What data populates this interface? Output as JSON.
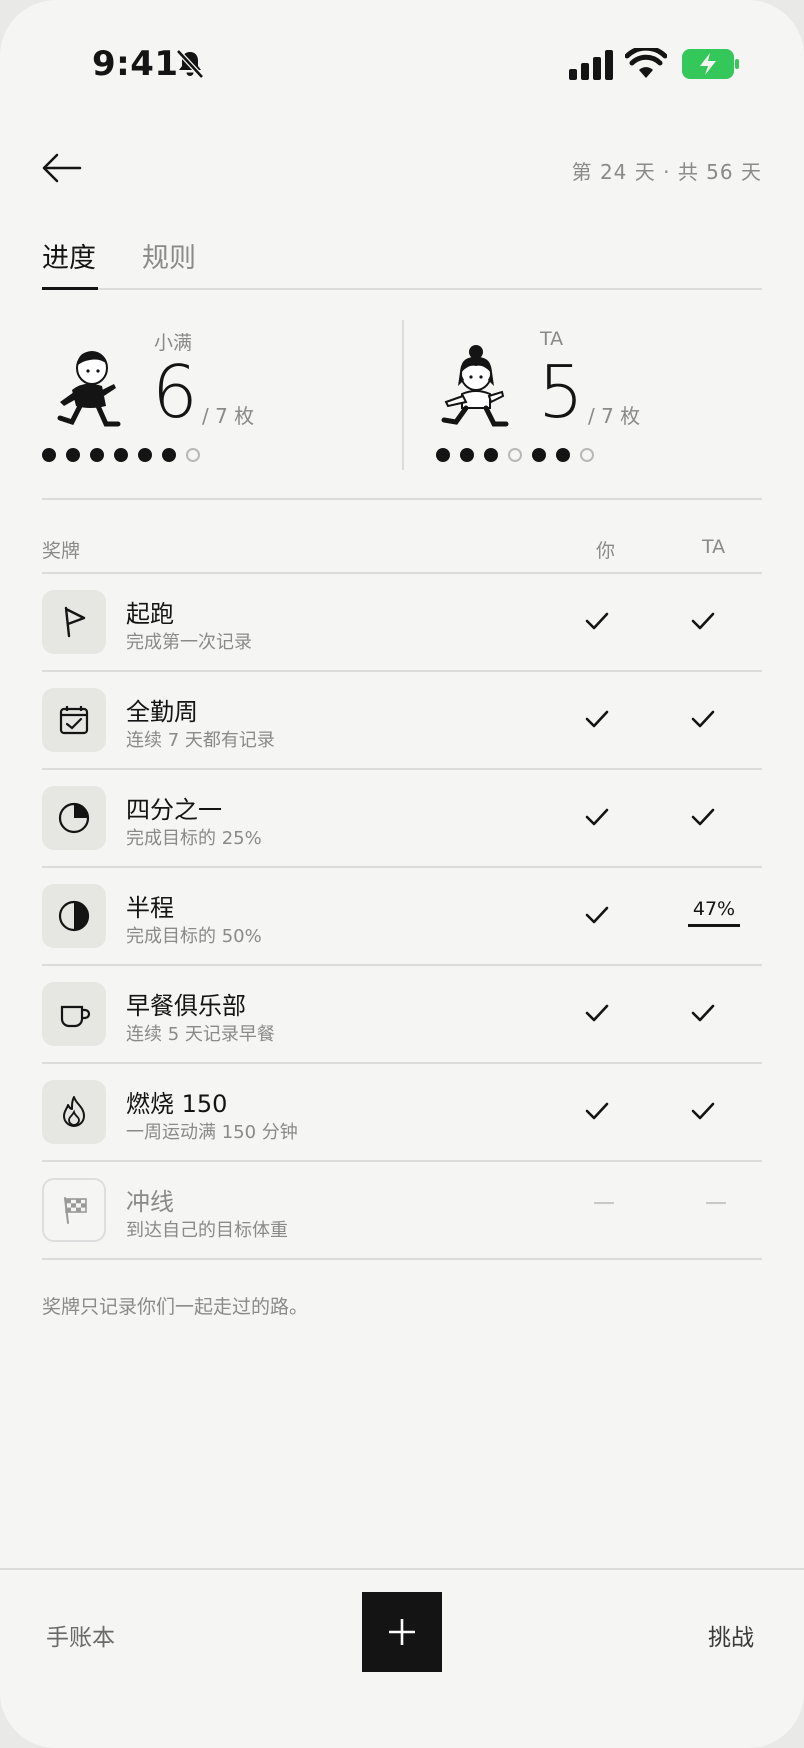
{
  "status_bar": {
    "time": "9:41",
    "icons": [
      "bell-slash-icon",
      "cellular-signal-icon",
      "wifi-icon",
      "battery-charging-icon"
    ],
    "battery_color": "#34c759"
  },
  "header": {
    "back_icon": "arrow-left-icon",
    "day_counter": "第 24 天 · 共 56 天"
  },
  "tabs": [
    {
      "label": "进度",
      "active": true
    },
    {
      "label": "规则",
      "active": false
    }
  ],
  "scores": {
    "me": {
      "name": "小满",
      "count": "6",
      "total": "/ 7 枚",
      "dots": [
        true,
        true,
        true,
        true,
        true,
        true,
        false
      ]
    },
    "ta": {
      "name": "TA",
      "count": "5",
      "total": "/ 7 枚",
      "dots": [
        true,
        true,
        true,
        false,
        true,
        true,
        false
      ]
    }
  },
  "medals_table": {
    "headers": {
      "medal": "奖牌",
      "you": "你",
      "ta": "TA"
    },
    "rows": [
      {
        "icon": "flag-icon",
        "title": "起跑",
        "desc": "完成第一次记录",
        "you": "check",
        "ta": "check"
      },
      {
        "icon": "calendar-check-icon",
        "title": "全勤周",
        "desc": "连续 7 天都有记录",
        "you": "check",
        "ta": "check"
      },
      {
        "icon": "quarter-pie-icon",
        "title": "四分之一",
        "desc": "完成目标的 25%",
        "you": "check",
        "ta": "check"
      },
      {
        "icon": "half-circle-icon",
        "title": "半程",
        "desc": "完成目标的 50%",
        "you": "check",
        "ta": "47%"
      },
      {
        "icon": "coffee-cup-icon",
        "title": "早餐俱乐部",
        "desc": "连续 5 天记录早餐",
        "you": "check",
        "ta": "check"
      },
      {
        "icon": "fire-icon",
        "title": "燃烧 150",
        "desc": "一周运动满 150 分钟",
        "you": "check",
        "ta": "check"
      },
      {
        "icon": "checkered-flag-icon",
        "title": "冲线",
        "desc": "到达自己的目标体重",
        "you": "—",
        "ta": "—"
      }
    ]
  },
  "footnote": "奖牌只记录你们一起走过的路。",
  "bottom_nav": {
    "left": "手账本",
    "center_icon": "plus-icon",
    "right": "挑战"
  }
}
